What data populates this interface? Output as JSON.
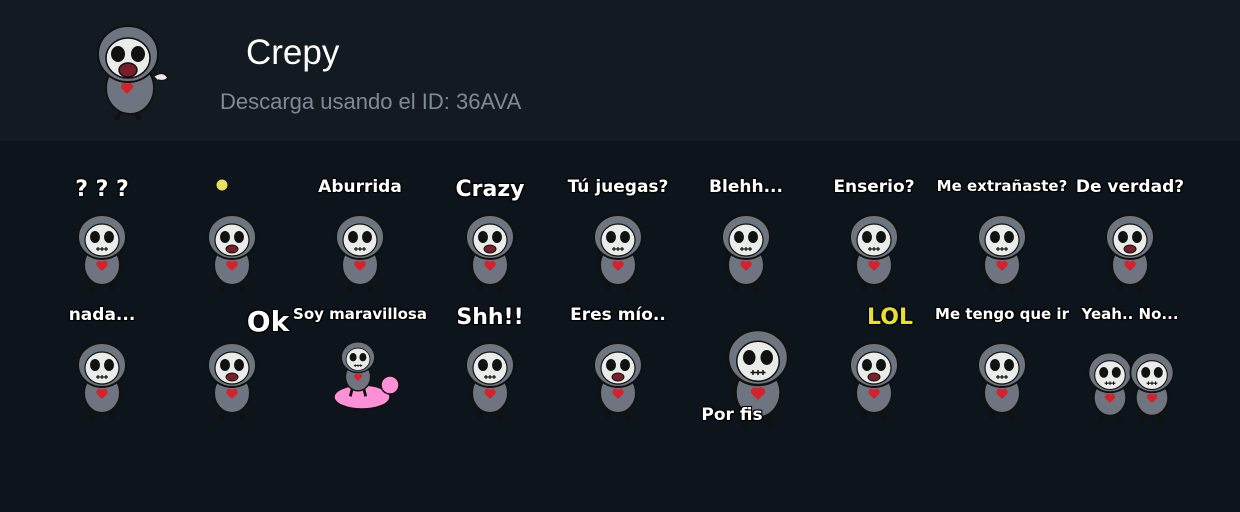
{
  "pack": {
    "title": "Crepy",
    "subtitle": "Descarga usando el ID: 36AVA",
    "icon": "crepy-character"
  },
  "colors": {
    "header_bg": "#131a22",
    "grid_bg": "#0d141c",
    "title": "#ffffff",
    "subtitle": "#7f8a95",
    "hoodie": "#6e7580",
    "face": "#e9ece8",
    "heart": "#d3222a",
    "lol": "#e8e030",
    "unicorn": "#ff8fd6"
  },
  "stickers": [
    {
      "name": "confused",
      "caption": "? ?  ?"
    },
    {
      "name": "idea",
      "caption": ""
    },
    {
      "name": "bored",
      "caption": "Aburrida"
    },
    {
      "name": "crazy",
      "caption": "Crazy"
    },
    {
      "name": "gaming",
      "caption": "Tú juegas?"
    },
    {
      "name": "blehh",
      "caption": "Blehh..."
    },
    {
      "name": "serious",
      "caption": "Enserio?"
    },
    {
      "name": "miss-me",
      "caption": "Me extrañaste?"
    },
    {
      "name": "really",
      "caption": "De verdad?"
    },
    {
      "name": "nada",
      "caption": "nada..."
    },
    {
      "name": "ok",
      "caption": "Ok"
    },
    {
      "name": "marvelous",
      "caption": "Soy maravillosa"
    },
    {
      "name": "shh",
      "caption": "Shh!!"
    },
    {
      "name": "yours",
      "caption": "Eres mío.."
    },
    {
      "name": "please",
      "caption": "Por fis"
    },
    {
      "name": "lol",
      "caption": "LOL"
    },
    {
      "name": "have-to-go",
      "caption": "Me tengo que ir"
    },
    {
      "name": "yeah-no",
      "caption": "Yeah..   No..."
    }
  ]
}
